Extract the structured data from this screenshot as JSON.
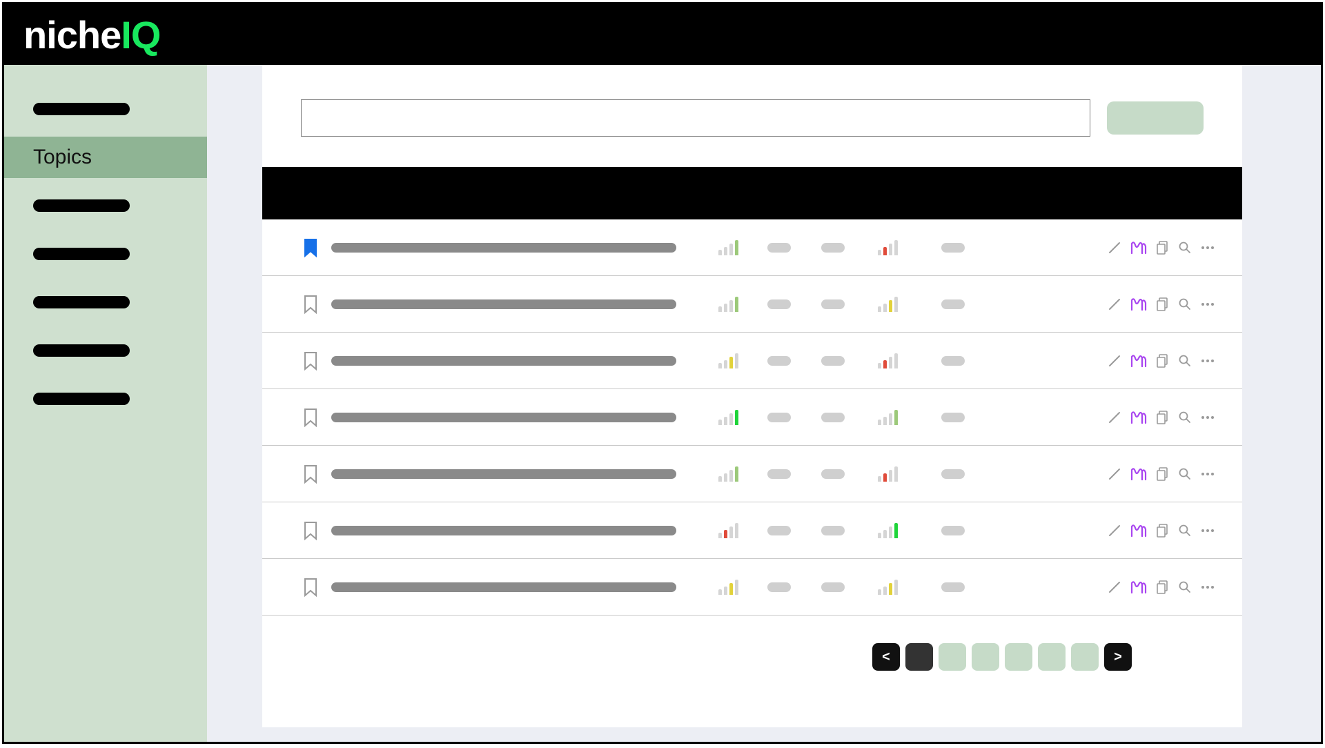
{
  "brand": {
    "part1": "niche",
    "part2": "IQ"
  },
  "sidebar": {
    "items": [
      {
        "label": "",
        "active": false
      },
      {
        "label": "Topics",
        "active": true
      },
      {
        "label": "",
        "active": false
      },
      {
        "label": "",
        "active": false
      },
      {
        "label": "",
        "active": false
      },
      {
        "label": "",
        "active": false
      },
      {
        "label": "",
        "active": false
      }
    ]
  },
  "search": {
    "value": "",
    "placeholder": ""
  },
  "colors": {
    "green_bright": "#1fd43a",
    "green_mid": "#9cc97a",
    "yellow": "#e2d23a",
    "red": "#e04b3a",
    "grey": "#d5d5d5"
  },
  "rows": [
    {
      "bookmarked": true,
      "signal1": [
        1,
        2,
        3,
        4
      ],
      "signal1_active": 4,
      "signal1_color": "green_mid",
      "signal2": [
        1,
        2,
        3,
        4
      ],
      "signal2_active": 2,
      "signal2_color": "red"
    },
    {
      "bookmarked": false,
      "signal1": [
        1,
        2,
        3,
        4
      ],
      "signal1_active": 4,
      "signal1_color": "green_mid",
      "signal2": [
        1,
        2,
        3,
        4
      ],
      "signal2_active": 3,
      "signal2_color": "yellow"
    },
    {
      "bookmarked": false,
      "signal1": [
        1,
        2,
        3,
        4
      ],
      "signal1_active": 3,
      "signal1_color": "yellow",
      "signal2": [
        1,
        2,
        3,
        4
      ],
      "signal2_active": 2,
      "signal2_color": "red"
    },
    {
      "bookmarked": false,
      "signal1": [
        1,
        2,
        3,
        4
      ],
      "signal1_active": 4,
      "signal1_color": "green_bright",
      "signal2": [
        1,
        2,
        3,
        4
      ],
      "signal2_active": 4,
      "signal2_color": "green_mid"
    },
    {
      "bookmarked": false,
      "signal1": [
        1,
        2,
        3,
        4
      ],
      "signal1_active": 4,
      "signal1_color": "green_mid",
      "signal2": [
        1,
        2,
        3,
        4
      ],
      "signal2_active": 2,
      "signal2_color": "red"
    },
    {
      "bookmarked": false,
      "signal1": [
        1,
        2,
        3,
        4
      ],
      "signal1_active": 2,
      "signal1_color": "red",
      "signal2": [
        1,
        2,
        3,
        4
      ],
      "signal2_active": 4,
      "signal2_color": "green_bright"
    },
    {
      "bookmarked": false,
      "signal1": [
        1,
        2,
        3,
        4
      ],
      "signal1_active": 3,
      "signal1_color": "yellow",
      "signal2": [
        1,
        2,
        3,
        4
      ],
      "signal2_active": 3,
      "signal2_color": "yellow"
    }
  ],
  "pagination": {
    "prev": "<",
    "next": ">",
    "pages": [
      "",
      "",
      "",
      "",
      ""
    ],
    "current_index": 0
  },
  "icons": {
    "edit": "edit-icon",
    "wave": "wave-icon",
    "copy": "copy-icon",
    "search": "search-icon",
    "more": "more-icon"
  }
}
